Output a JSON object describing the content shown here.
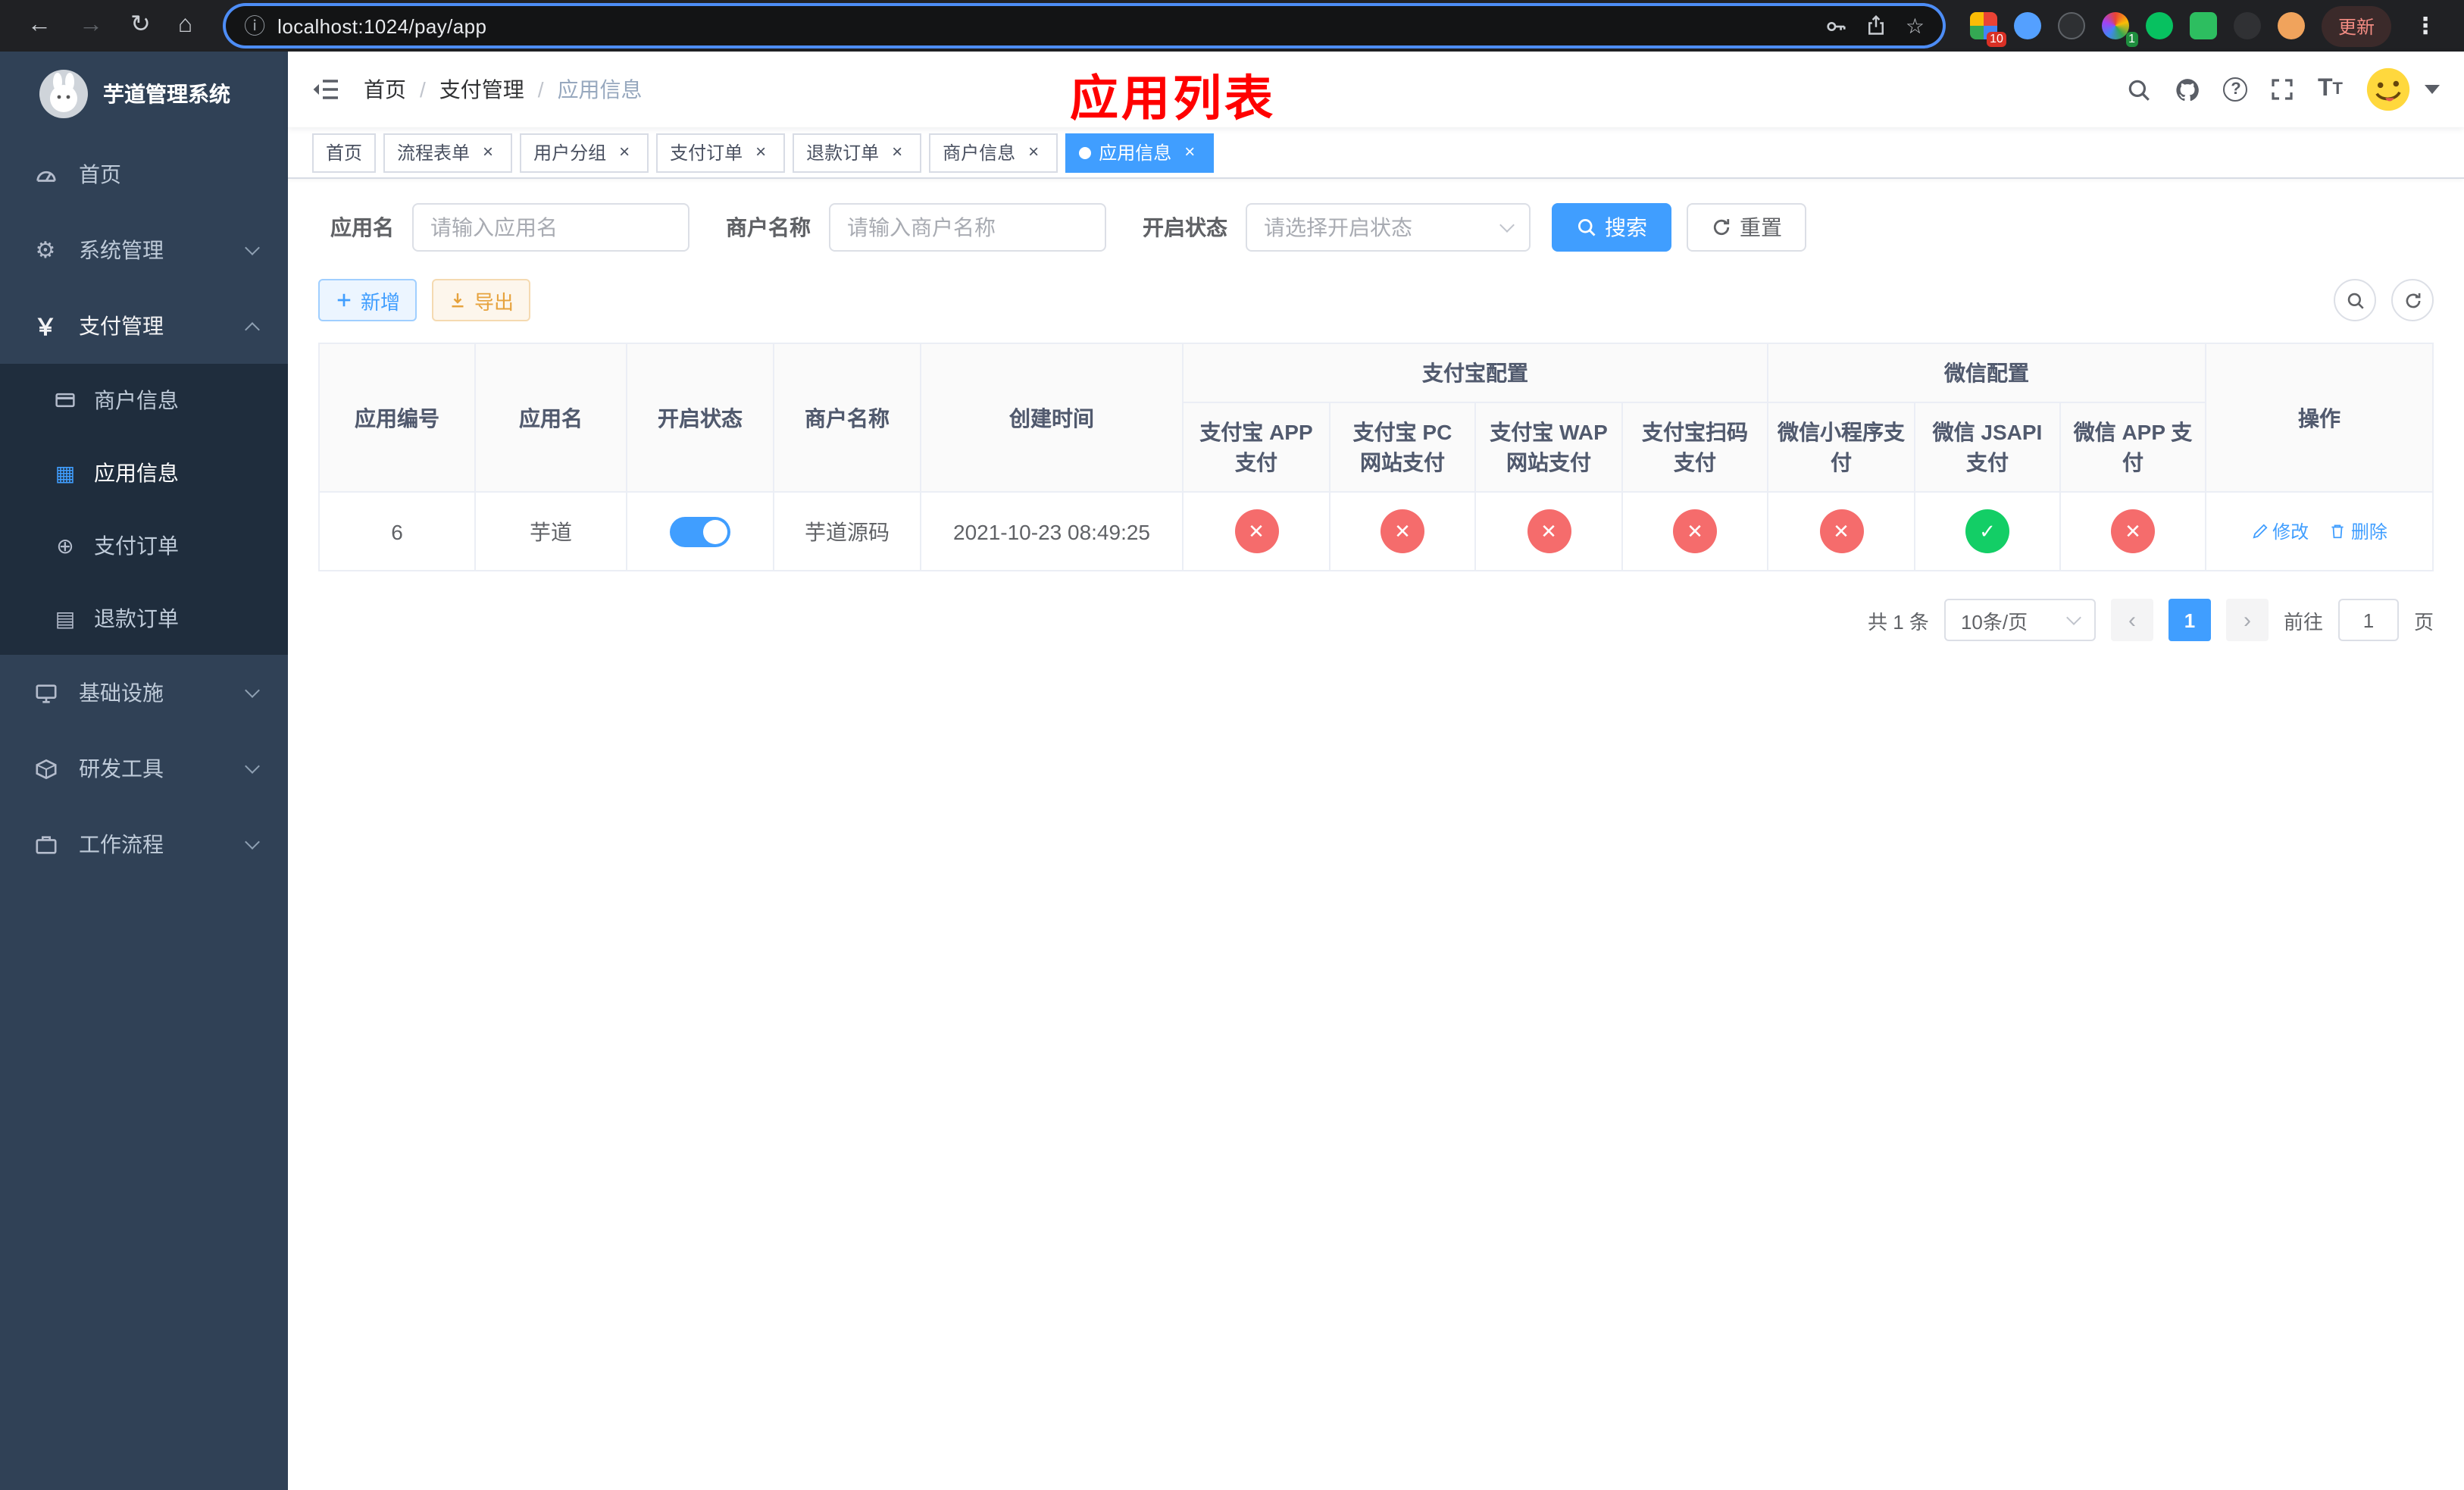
{
  "browser": {
    "url": "localhost:1024/pay/app",
    "update_label": "更新",
    "badges": {
      "extensions_red": "10",
      "extensions_green": "1"
    }
  },
  "sidebar": {
    "title": "芋道管理系统",
    "home": "首页",
    "system": "系统管理",
    "payment": "支付管理",
    "merchant_info": "商户信息",
    "app_info": "应用信息",
    "pay_order": "支付订单",
    "refund_order": "退款订单",
    "infra": "基础设施",
    "dev_tools": "研发工具",
    "workflow": "工作流程"
  },
  "navbar": {
    "breadcrumb_home": "首页",
    "breadcrumb_pay": "支付管理",
    "breadcrumb_current": "应用信息",
    "breadcrumb_sep": "/",
    "overlay_title": "应用列表"
  },
  "tabs": [
    {
      "label": "首页"
    },
    {
      "label": "流程表单"
    },
    {
      "label": "用户分组"
    },
    {
      "label": "支付订单"
    },
    {
      "label": "退款订单"
    },
    {
      "label": "商户信息"
    },
    {
      "label": "应用信息"
    }
  ],
  "filters": {
    "app_name_label": "应用名",
    "app_name_placeholder": "请输入应用名",
    "merchant_label": "商户名称",
    "merchant_placeholder": "请输入商户名称",
    "status_label": "开启状态",
    "status_placeholder": "请选择开启状态",
    "search": "搜索",
    "reset": "重置"
  },
  "toolbar": {
    "add": "新增",
    "export": "导出"
  },
  "table": {
    "headers": {
      "app_id": "应用编号",
      "app_name": "应用名",
      "status": "开启状态",
      "merchant_name": "商户名称",
      "create_time": "创建时间",
      "alipay_group": "支付宝配置",
      "wechat_group": "微信配置",
      "alipay_app": "支付宝 APP 支付",
      "alipay_pc": "支付宝 PC 网站支付",
      "alipay_wap": "支付宝 WAP 网站支付",
      "alipay_scan": "支付宝扫码支付",
      "wechat_mini": "微信小程序支付",
      "wechat_jsapi": "微信 JSAPI 支付",
      "wechat_app": "微信 APP 支付",
      "actions": "操作"
    },
    "rows": [
      {
        "app_id": "6",
        "app_name": "芋道",
        "enabled": true,
        "merchant_name": "芋道源码",
        "create_time": "2021-10-23 08:49:25",
        "statuses": {
          "alipay_app": "no",
          "alipay_pc": "no",
          "alipay_wap": "no",
          "alipay_scan": "no",
          "wechat_mini": "no",
          "wechat_jsapi": "yes",
          "wechat_app": "no"
        },
        "edit_label": "修改",
        "delete_label": "删除"
      }
    ]
  },
  "pagination": {
    "total": "共 1 条",
    "page_size": "10条/页",
    "current_page": "1",
    "goto_prefix": "前往",
    "goto_value": "1",
    "goto_suffix": "页"
  },
  "colors": {
    "primary": "#409eff",
    "success": "#13ce66",
    "danger": "#f56c6c",
    "warning": "#e6a23c",
    "sidebar_bg": "#304156",
    "submenu_bg": "#1f2d3d",
    "annotation_red": "#ff0000"
  }
}
